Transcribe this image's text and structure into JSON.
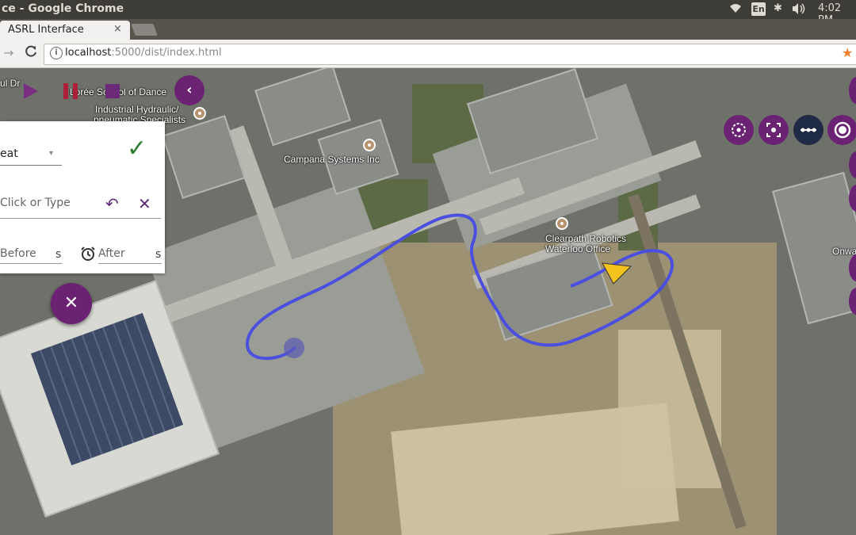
{
  "os": {
    "window_title": "ce - Google Chrome",
    "lang": "En",
    "volume_icon": "volume-icon",
    "time": "4:02 PM"
  },
  "browser": {
    "tab_title": "ASRL Interface",
    "tab_close": "×",
    "url_host": "localhost",
    "url_rest": ":5000/dist/index.html",
    "forward": "→",
    "reload": "C",
    "info": "i",
    "star": "★"
  },
  "map": {
    "labels": {
      "dance_school": "Lorée School of Dance",
      "industrial": "Industrial Hydraulic/",
      "pneumatic": "pneumatic Specialists",
      "campana": "Campana Systems Inc",
      "clearpath1": "Clearpath Robotics",
      "clearpath2": "Waterloo Office",
      "onwa": "Onwa",
      "street_fragment": "ul Dr"
    }
  },
  "controls": {
    "collapse": "‹",
    "mode_value": "eat",
    "mode_caret": "▾",
    "confirm": "✓",
    "target_placeholder": "Click or Type",
    "undo": "↶",
    "clear": "✕",
    "before_placeholder": "Before",
    "before_unit": "s",
    "after_placeholder": "After",
    "after_unit": "s",
    "close": "✕"
  },
  "right_toolbar": {
    "buttons": [
      "center-icon",
      "fit-view-icon",
      "path-icon",
      "target-icon"
    ]
  },
  "colors": {
    "accent": "#6b2273",
    "path": "#4b4fe0",
    "robot": "#f4c21c",
    "pause": "#b01f3a",
    "confirm": "#2e7d32"
  }
}
